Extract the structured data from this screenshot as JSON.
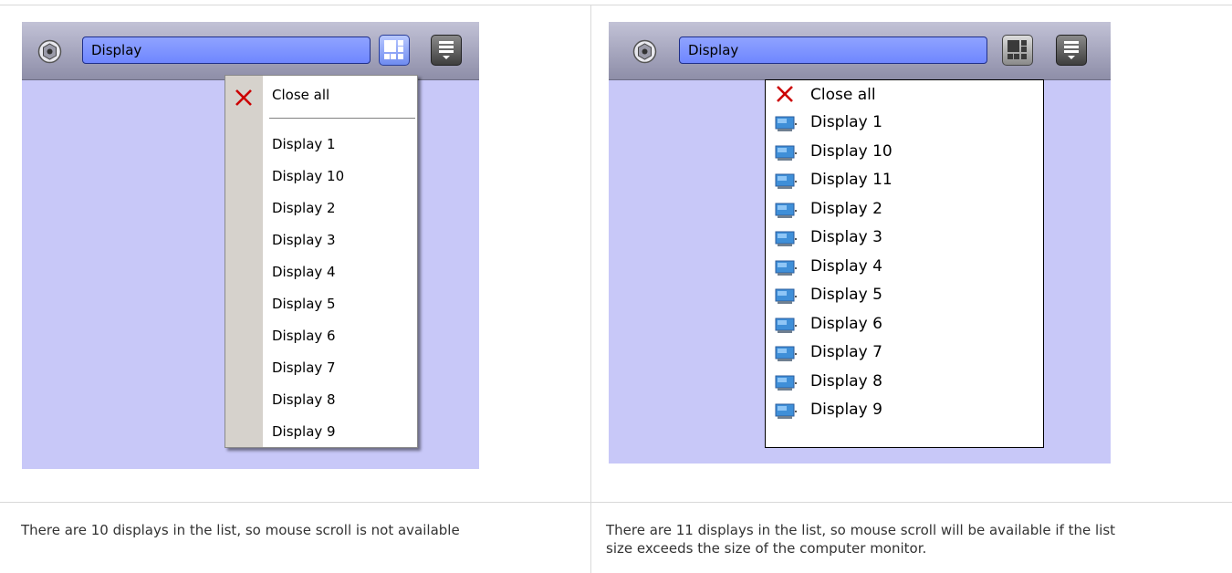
{
  "left_panel": {
    "toolbar": {
      "display_value": "Display"
    },
    "menu": {
      "close_all": "Close all",
      "items": [
        "Display 1",
        "Display 10",
        "Display 2",
        "Display 3",
        "Display 4",
        "Display 5",
        "Display 6",
        "Display 7",
        "Display 8",
        "Display 9"
      ]
    },
    "caption": "There are 10 displays in the list, so mouse scroll is not available"
  },
  "right_panel": {
    "toolbar": {
      "display_value": "Display"
    },
    "menu": {
      "close_all": "Close all",
      "items": [
        "Display 1",
        "Display 10",
        "Display 11",
        "Display 2",
        "Display 3",
        "Display 4",
        "Display 5",
        "Display 6",
        "Display 7",
        "Display 8",
        "Display 9"
      ]
    },
    "caption_line1": "There are 11 displays in the list, so mouse scroll will be available if the list",
    "caption_line2": "size exceeds the size of the computer monitor."
  },
  "colors": {
    "toolbar": "#a5a5bd",
    "field": "#7a90ff",
    "background": "#c8c8f8"
  },
  "icons": [
    "camera-icon",
    "layout-grid-icon",
    "menu-list-icon",
    "close-x-icon",
    "monitor-icon"
  ]
}
